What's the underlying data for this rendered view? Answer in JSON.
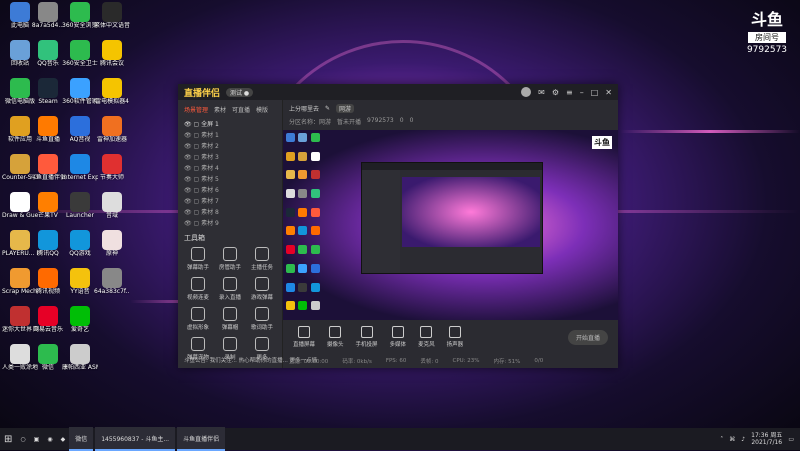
{
  "desktop": {
    "col1": [
      {
        "label": "此电脑",
        "icon": "computer-icon",
        "color": "#3d7bd6"
      },
      {
        "label": "回收站",
        "icon": "recycle-bin-icon",
        "color": "#6aa0d8"
      },
      {
        "label": "微信电脑版",
        "icon": "wechat-icon",
        "color": "#2dbb4e"
      },
      {
        "label": "软件应用",
        "icon": "folder-icon",
        "color": "#e0a020"
      },
      {
        "label": "Counter-S Global Of...",
        "icon": "csgo-icon",
        "color": "#d6a23a"
      },
      {
        "label": "Draw & Guess",
        "icon": "draw-guess-icon",
        "color": "#ffffff"
      },
      {
        "label": "PLAYERU... BATTLEGR...",
        "icon": "pubg-icon",
        "color": "#e6b84a"
      },
      {
        "label": "Scrap Mechanic",
        "icon": "scrap-mechanic-icon",
        "color": "#f09a30"
      },
      {
        "label": "迷你大世界 Dance of F...",
        "icon": "game-icon",
        "color": "#c03030"
      },
      {
        "label": "人类一败涂地 Human Fa...",
        "icon": "human-fall-flat-icon",
        "color": "#dddddd"
      }
    ],
    "col2": [
      {
        "label": "8a7a5d4...",
        "icon": "file-icon",
        "color": "#888888"
      },
      {
        "label": "QQ音乐",
        "icon": "qq-music-icon",
        "color": "#31c27c"
      },
      {
        "label": "Steam",
        "icon": "steam-icon",
        "color": "#1b2838"
      },
      {
        "label": "斗鱼直播",
        "icon": "douyu-icon",
        "color": "#ff7a00"
      },
      {
        "label": "斗鱼直播伴侣",
        "icon": "douyu-companion-icon",
        "color": "#ff5a3c"
      },
      {
        "label": "芒果TV",
        "icon": "mango-tv-icon",
        "color": "#ff7f00"
      },
      {
        "label": "腾讯QQ",
        "icon": "qq-icon",
        "color": "#1296db"
      },
      {
        "label": "腾讯视频",
        "icon": "tencent-video-icon",
        "color": "#ff6a00"
      },
      {
        "label": "网易云音乐",
        "icon": "netease-music-icon",
        "color": "#e60026"
      },
      {
        "label": "微信",
        "icon": "wechat-icon",
        "color": "#2dbb4e"
      }
    ],
    "col3": [
      {
        "label": "360安全浏览器",
        "icon": "browser-360-icon",
        "color": "#2dbb4e"
      },
      {
        "label": "360安全卫士",
        "icon": "security-360-icon",
        "color": "#2dbb4e"
      },
      {
        "label": "360软件管家",
        "icon": "software-manager-icon",
        "color": "#3ba1ff"
      },
      {
        "label": "AQ音视",
        "icon": "aq-icon",
        "color": "#2c6fdc"
      },
      {
        "label": "Internet Explorer",
        "icon": "ie-icon",
        "color": "#1e88e5"
      },
      {
        "label": "Launcher",
        "icon": "launcher-icon",
        "color": "#3a3a3a"
      },
      {
        "label": "QQ游戏",
        "icon": "qq-game-icon",
        "color": "#1296db"
      },
      {
        "label": "YY语音",
        "icon": "yy-icon",
        "color": "#f4c20d"
      },
      {
        "label": "爱奇艺",
        "icon": "iqiyi-icon",
        "color": "#00be06"
      },
      {
        "label": "康帕西亚 ASMR初...",
        "icon": "app-icon",
        "color": "#cccccc"
      }
    ],
    "col4": [
      {
        "label": "繁体中文语音 录音机",
        "icon": "recorder-icon",
        "color": "#2a2a2a"
      },
      {
        "label": "腾讯会议",
        "icon": "meeting-icon",
        "color": "#f5c400"
      },
      {
        "label": "雷电模拟器4",
        "icon": "ldplayer-icon",
        "color": "#f5c400"
      },
      {
        "label": "雷神加速器",
        "icon": "accelerator-icon",
        "color": "#f07020"
      },
      {
        "label": "节奏大师",
        "icon": "rhythm-icon",
        "color": "#e03030"
      },
      {
        "label": "音域",
        "icon": "music-icon",
        "color": "#dddddd"
      },
      {
        "label": "原神",
        "icon": "genshin-icon",
        "color": "#f0e0e0"
      },
      {
        "label": "64a383c7f...",
        "icon": "file-icon",
        "color": "#888888"
      }
    ]
  },
  "room_badge": {
    "logo": "斗鱼",
    "title": "房间号",
    "number": "9792573"
  },
  "window": {
    "app_name": "直播伴侣",
    "version": "测试 ●",
    "tabs": [
      "场景管理",
      "素材",
      "可直播",
      "模版"
    ],
    "scene": "全屏 1",
    "scene_items": [
      "素材 1",
      "素材 2",
      "素材 3",
      "素材 4",
      "素材 5",
      "素材 6",
      "素材 7",
      "素材 8",
      "素材 9"
    ],
    "tools_title": "工具箱",
    "tools": [
      "弹幕助手",
      "房管助手",
      "主播任务",
      "视频连麦",
      "录入直播",
      "游戏弹幕",
      "虚拟形象",
      "弹幕帽",
      "歌词助手",
      "弹幕宠物",
      "录制",
      "更多"
    ],
    "notice": "斗鱼公告: 我们关注... 热心帮助你的直播... 更多一点情",
    "room_title": "上分哪里去",
    "room_tag": "网游",
    "room_info": [
      "分区名称：网游",
      "暂未开播",
      "9792573",
      "0",
      "0"
    ],
    "controls": [
      "直播屏幕",
      "摄像头",
      "手机投屏",
      "多媒体",
      "麦克风",
      "扬声器"
    ],
    "start_label": "开始直播",
    "status": [
      "直播: 00:00:00",
      "码率: 0kb/s",
      "FPS: 60",
      "丢帧: 0",
      "CPU: 23%",
      "内存: 51%",
      "0/0"
    ]
  },
  "taskbar": {
    "items": [
      "微信",
      "1455960837 - 斗鱼主...",
      "斗鱼直播伴侣"
    ],
    "time": "17:36 周五",
    "date": "2021/7/16"
  }
}
